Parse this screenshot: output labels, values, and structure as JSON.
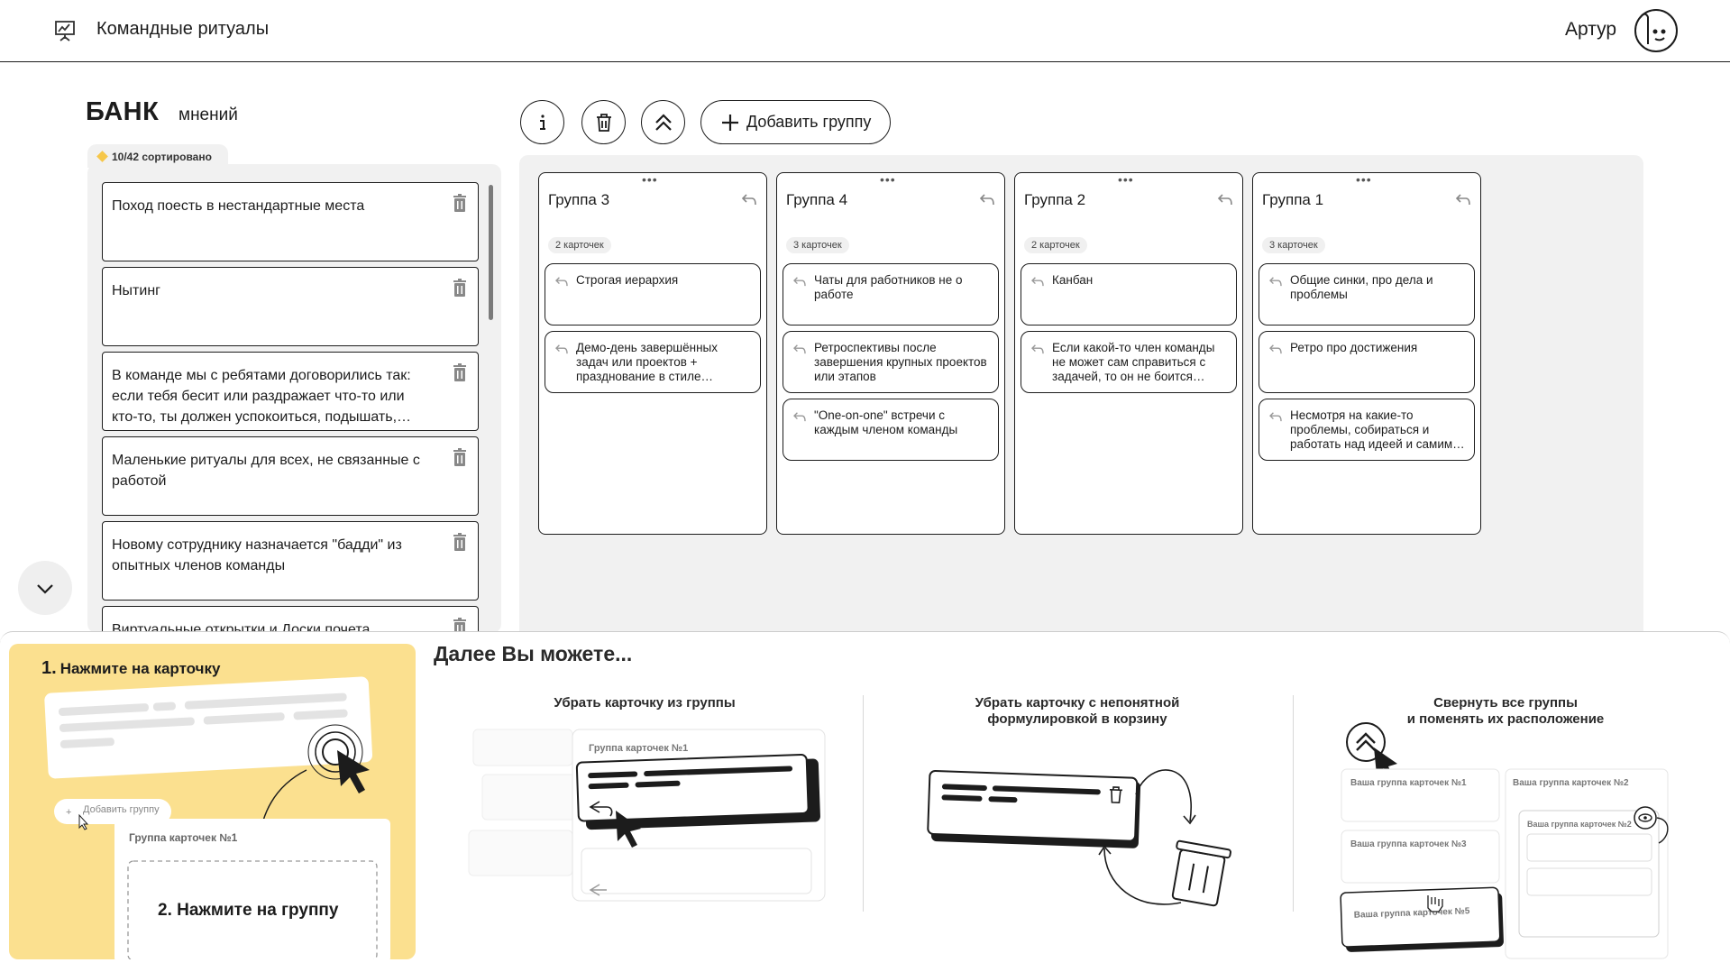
{
  "header": {
    "title": "Командные ритуалы",
    "user_name": "Артур"
  },
  "bank": {
    "title": "БАНК",
    "subtitle": "мнений",
    "sorted_badge": "10/42 сортировано",
    "cards": [
      "Поход поесть в нестандартные места",
      "Нытинг",
      "В команде мы с ребятами договорились так: если тебя бесит или раздражает что-то или кто-то, ты должен успокоиться, подышать, ничего не делать сгоряча",
      "Маленькие ритуалы для всех, не связанные с работой",
      "Новому сотруднику назначается \"бадди\" из опытных членов команды",
      "Виртуальные открытки и Доски почета"
    ]
  },
  "toolbar": {
    "add_group_label": "Добавить группу"
  },
  "groups": [
    {
      "title": "Группа 3",
      "count": "2 карточек",
      "cards": [
        "Строгая иерархия",
        "Демо-день завершённых задач или проектов + празднование в стиле вечеринки"
      ]
    },
    {
      "title": "Группа 4",
      "count": "3 карточек",
      "cards": [
        "Чаты для работников не о работе",
        "Ретроспективы после завершения крупных проектов или этапов",
        "\"One-on-one\" встречи с каждым членом команды"
      ]
    },
    {
      "title": "Группа 2",
      "count": "2 карточек",
      "cards": [
        "Канбан",
        "Если какой-то член команды не может сам справиться с задачей, то он не боится попросить помощи"
      ]
    },
    {
      "title": "Группа 1",
      "count": "3 карточек",
      "cards": [
        "Общие синки, про дела и проблемы",
        "Ретро про достижения",
        "Несмотря на какие-то проблемы, собираться и работать над идеей и самими собой"
      ]
    }
  ],
  "onboarding": {
    "step1_num": "1.",
    "step1_label": "Нажмите на карточку",
    "step2_num": "2.",
    "step2_label": "Нажмите на группу",
    "mini_add_group": "Добавить группу",
    "mini_group_name": "Группа карточек №1",
    "heading": "Далее Вы можете...",
    "col1_title": "Убрать карточку из группы",
    "col1_group": "Группа карточек №1",
    "col2_title_l1": "Убрать карточку с непонятной",
    "col2_title_l2": "формулировкой в корзину",
    "col3_title_l1": "Свернуть все группы",
    "col3_title_l2": "и поменять их расположение",
    "col3_groups": [
      "Ваша группа карточек №1",
      "Ваша группа карточек №2",
      "Ваша группа карточек №3",
      "Ваша группа карточек №5",
      "Ваша группа карточек №2"
    ]
  },
  "colors": {
    "accent_yellow": "#fbe08f",
    "panel_gray": "#f1f1f1",
    "ink": "#1c1c1c"
  },
  "icons": [
    "presentation-board-icon",
    "avatar-face-icon",
    "info-icon",
    "trash-icon",
    "collapse-all-icon",
    "plus-icon",
    "return-arrow-icon",
    "chevron-down-icon",
    "eye-icon",
    "cursor-icon"
  ]
}
